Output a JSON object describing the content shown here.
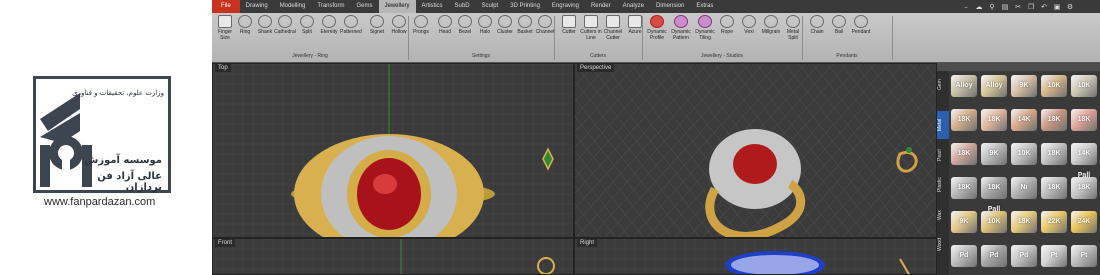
{
  "brand": {
    "line1": "وزارت علوم، تحقیقات و فناوری",
    "line2": "موسسه آموزش",
    "line3": "عالی آزاد فن پردازان",
    "website": "www.fanpardazan.com"
  },
  "tabs": [
    "File",
    "Drawing",
    "Modelling",
    "Transform",
    "Gems",
    "Jewellery",
    "Artistics",
    "SubD",
    "Sculpt",
    "3D Printing",
    "Engraving",
    "Render",
    "Analyze",
    "Dimension",
    "Extras"
  ],
  "active_tab": "Jewellery",
  "ribbon": {
    "buttons": [
      "Finger Size",
      "Ring",
      "Shank",
      "Cathedral",
      "Split",
      "Eternity",
      "Patterned",
      "Signet",
      "Hollow",
      "Prongs",
      "Head",
      "Bezel",
      "Halo",
      "Cluster",
      "Basket",
      "Channel",
      "Cutter",
      "Cutters in Line",
      "Channel Cutter",
      "Azure",
      "Dynamic Profile",
      "Dynamic Pattern",
      "Dynamic Tiling",
      "Rope",
      "Vexi",
      "Millgrain",
      "Metal Split",
      "Chain",
      "Bail",
      "Pendant"
    ],
    "groups": [
      "Jewellery - Ring",
      "Settings",
      "Cutters",
      "Jewellery - Studios",
      "Pendants"
    ]
  },
  "viewports": [
    "Top",
    "Perspective",
    "Front",
    "Right"
  ],
  "materials": {
    "side_tabs": [
      "Gem",
      "Metal",
      "Pearl",
      "Plastic",
      "Wax",
      "Wood"
    ],
    "active_side_tab": "Metal",
    "swatches": [
      {
        "label": "Alloy",
        "color": "#c9c0a8"
      },
      {
        "label": "Alloy",
        "color": "#d6c79a"
      },
      {
        "label": "9K",
        "color": "#d9bfa8"
      },
      {
        "label": "10K",
        "color": "#d6b58a"
      },
      {
        "label": "10K",
        "color": "#cfc6b6"
      },
      {
        "label": "18K",
        "color": "#d2b08c"
      },
      {
        "label": "18K",
        "color": "#e3b8a0"
      },
      {
        "label": "14K",
        "color": "#d9a98d"
      },
      {
        "label": "18K",
        "color": "#c99985"
      },
      {
        "label": "18K",
        "color": "#e0a49a"
      },
      {
        "label": "18K",
        "color": "#cfa9a0"
      },
      {
        "label": "9K",
        "color": "#bcbcbc"
      },
      {
        "label": "10K",
        "color": "#c7c7c7"
      },
      {
        "label": "18K",
        "color": "#c4c4c4"
      },
      {
        "label": "14K Pall",
        "color": "#cfcfcf"
      },
      {
        "label": "18K",
        "color": "#b8b8b8"
      },
      {
        "label": "18K Pall",
        "color": "#a9a9a9"
      },
      {
        "label": "Ni",
        "color": "#b4b4b4"
      },
      {
        "label": "18K",
        "color": "#bdbdbd"
      },
      {
        "label": "18K",
        "color": "#c8c8c8"
      },
      {
        "label": "9K",
        "color": "#e2c98a"
      },
      {
        "label": "10K",
        "color": "#dcc17b"
      },
      {
        "label": "18K",
        "color": "#e6cc7e"
      },
      {
        "label": "22K",
        "color": "#e9c86d"
      },
      {
        "label": "24K",
        "color": "#ebc35c"
      },
      {
        "label": "Pd",
        "color": "#bdbdbd"
      },
      {
        "label": "Pd",
        "color": "#a6a6a6"
      },
      {
        "label": "Pd",
        "color": "#c4c4c4"
      },
      {
        "label": "Pt",
        "color": "#d2d2d2"
      },
      {
        "label": "Pt",
        "color": "#bdbdbd"
      }
    ]
  }
}
